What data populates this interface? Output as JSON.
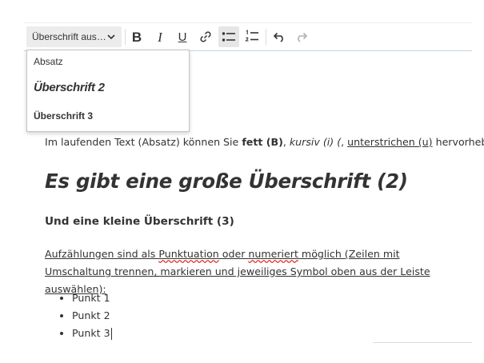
{
  "toolbar": {
    "heading_select_label": "Überschrift aus…",
    "buttons": {
      "bold": "B",
      "italic": "I",
      "underline": "U"
    }
  },
  "heading_dropdown": {
    "items": [
      "Absatz",
      "Überschrift 2",
      "Überschrift 3"
    ]
  },
  "content": {
    "paragraph1": {
      "part1": "Im laufenden Text (Absatz) können Sie ",
      "bold": "fett (B)",
      "part2": ", ",
      "italic": "kursiv (i) (",
      "part3": ", ",
      "underline": "unterstrichen (u)",
      "part4": " hervorheben."
    },
    "heading2": "Es gibt eine große Überschrift (2)",
    "heading3": "Und eine kleine Überschrift (3)",
    "paragraph2": {
      "t1": "Aufzählungen sind als ",
      "t2": "Punktuation",
      "t3": " oder ",
      "t4": "numeriert",
      "t5": " möglich (Zeilen mit Umschaltung trennen, markieren und jeweiliges Symbol oben aus der Leiste auswählen):"
    },
    "bullets": [
      "Punkt 1",
      "Punkt 2",
      "Punkt 3"
    ]
  }
}
